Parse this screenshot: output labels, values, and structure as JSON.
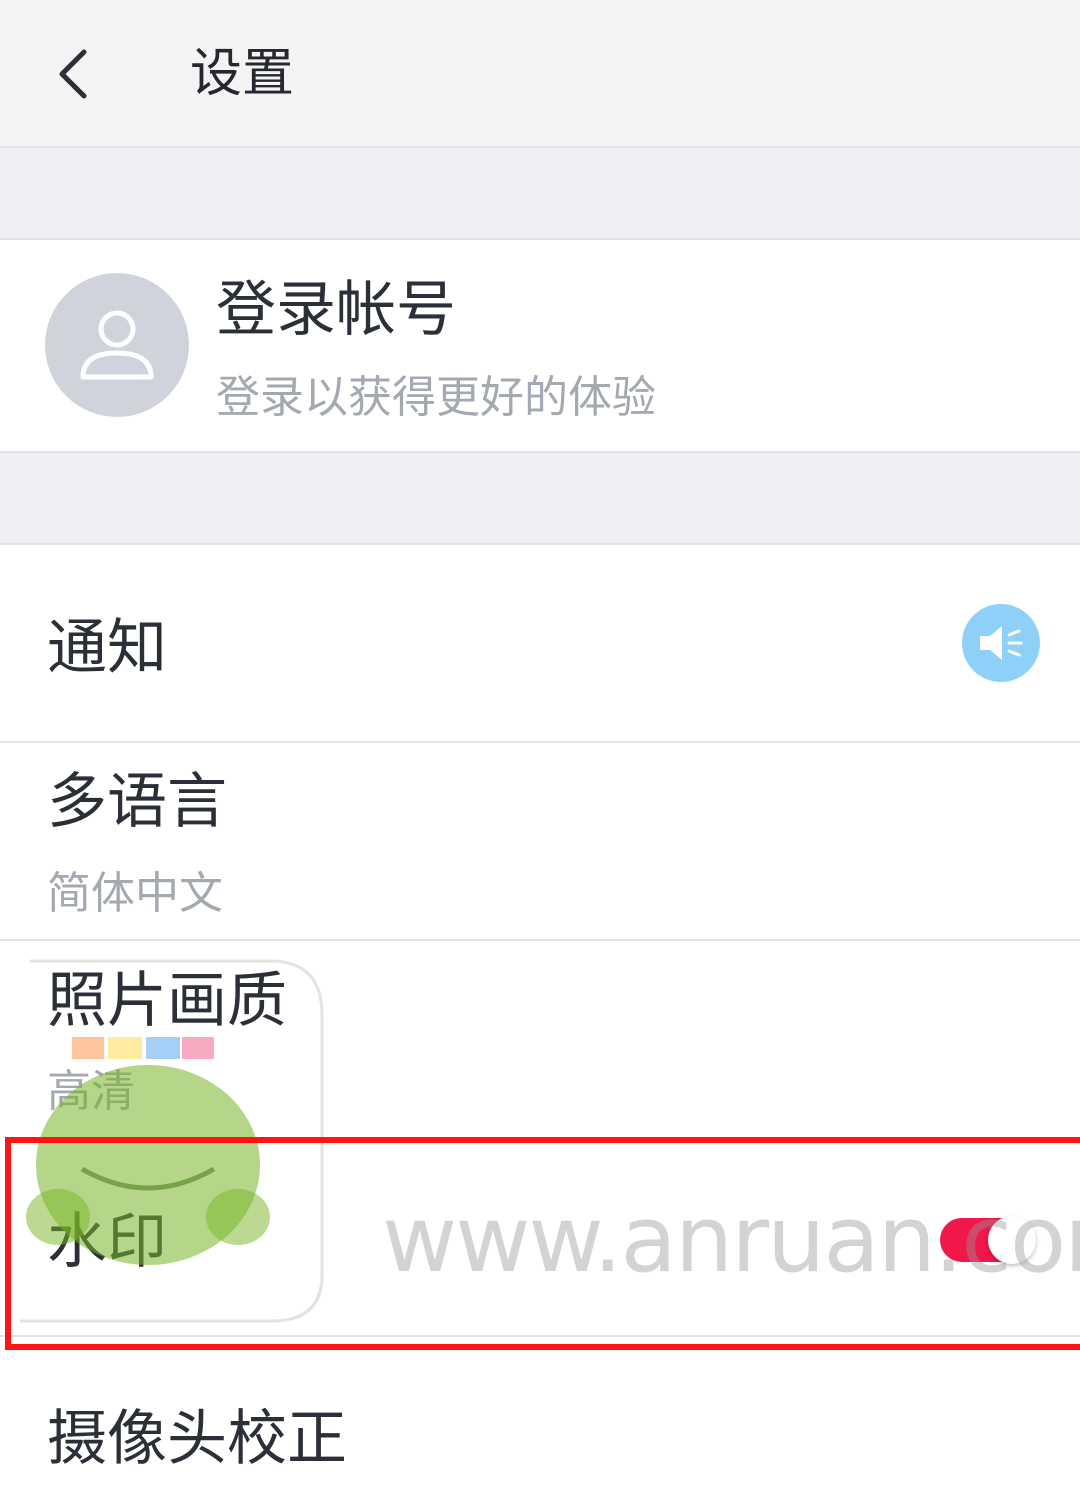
{
  "header": {
    "title": "设置"
  },
  "account": {
    "title": "登录帐号",
    "subtitle": "登录以获得更好的体验",
    "avatar_icon": "user-icon"
  },
  "settings": {
    "notification": {
      "label": "通知",
      "icon": "speaker-icon",
      "icon_color": "#8fd0f8"
    },
    "language": {
      "label": "多语言",
      "value": "简体中文"
    },
    "photo_quality": {
      "label": "照片画质",
      "value": "高清"
    },
    "watermark": {
      "label": "水印",
      "toggle_on": true,
      "toggle_color": "#f0184a"
    },
    "camera_calibration": {
      "label": "摄像头校正"
    }
  },
  "overlay": {
    "watermark_text": "www.anruan.com",
    "highlight_color": "#ff1414"
  }
}
